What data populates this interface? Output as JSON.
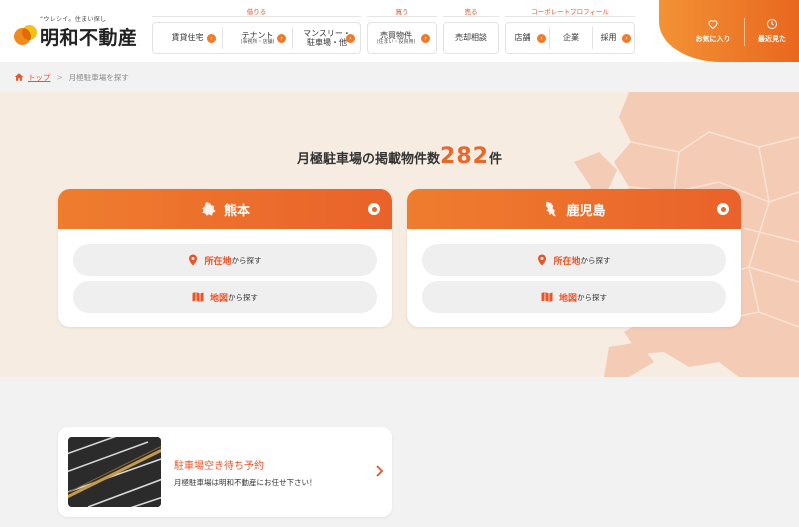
{
  "logo": {
    "tagline": "“ウレシイ。住まい探し",
    "name": "明和不動産"
  },
  "nav": {
    "groups": [
      {
        "label": "借りる",
        "items": [
          {
            "label": "賃貸住宅",
            "sub": ""
          },
          {
            "label": "テナント",
            "sub": "(事務所・店舗)"
          },
          {
            "label": "マンスリー・",
            "label2": "駐車場・他",
            "sub": ""
          }
        ]
      },
      {
        "label": "買う",
        "items": [
          {
            "label": "売買物件",
            "sub": "(住まい・投資用)"
          }
        ]
      },
      {
        "label": "売る",
        "items": [
          {
            "label": "売却相談",
            "sub": ""
          }
        ]
      },
      {
        "label": "コーポレートプロフィール",
        "items": [
          {
            "label": "店舗"
          },
          {
            "label": "企業"
          },
          {
            "label": "採用"
          }
        ]
      }
    ],
    "favorites": "お気に入り",
    "recent": "最近見た"
  },
  "breadcrumb": {
    "home": "トップ",
    "sep": ">",
    "current": "月極駐車場を探す"
  },
  "hero": {
    "count_prefix": "月極駐車場の掲載物件数",
    "count": "282",
    "count_unit": "件"
  },
  "prefectures": [
    {
      "name": "熊本",
      "by_location": "所在地",
      "by_location_suffix": "から探す",
      "by_map": "地図",
      "by_map_suffix": "から探す"
    },
    {
      "name": "鹿児島",
      "by_location": "所在地",
      "by_location_suffix": "から探す",
      "by_map": "地図",
      "by_map_suffix": "から探す"
    }
  ],
  "reserve": {
    "title": "駐車場空き待ち予約",
    "subtitle": "月極駐車場は明和不動産にお任せ下さい！"
  },
  "colors": {
    "accent": "#e8672a",
    "hero_bg": "#f7ece2",
    "map": "#f4cbb5"
  },
  "icons": [
    "home-icon",
    "heart-icon",
    "clock-icon",
    "pin-icon",
    "map-icon",
    "chevron-right-icon"
  ]
}
